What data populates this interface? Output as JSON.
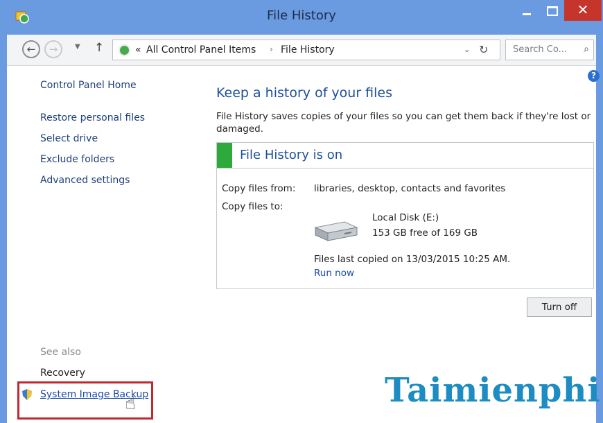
{
  "window": {
    "title": "File History",
    "controls": {
      "minimize_icon": "minimize-icon",
      "maximize_icon": "maximize-icon",
      "close_icon": "close-icon"
    }
  },
  "navigation": {
    "back_icon": "back-arrow-icon",
    "forward_icon": "forward-arrow-icon",
    "up_icon": "up-arrow-icon",
    "address": {
      "overflow": "«",
      "crumbs": [
        "All Control Panel Items",
        "File History"
      ],
      "separator": "›"
    },
    "search": {
      "placeholder": "Search Co..."
    }
  },
  "sidebar": {
    "home": "Control Panel Home",
    "links": [
      "Restore personal files",
      "Select drive",
      "Exclude folders",
      "Advanced settings"
    ],
    "see_also": {
      "title": "See also",
      "items": [
        "Recovery",
        "System Image Backup"
      ]
    }
  },
  "main": {
    "heading": "Keep a history of your files",
    "description": "File History saves copies of your files so you can get them back if they're lost or damaged.",
    "status": {
      "text": "File History is on",
      "color": "#2eaa3c"
    },
    "copy_from_label": "Copy files from:",
    "copy_from_value": "libraries, desktop, contacts and favorites",
    "copy_to_label": "Copy files to:",
    "drive": {
      "name": "Local Disk (E:)",
      "free": "153 GB free of 169 GB"
    },
    "last_copied": "Files last copied on 13/03/2015 10:25 AM.",
    "run_now": "Run now",
    "turn_off": "Turn off"
  },
  "watermark": "Taimienphi"
}
